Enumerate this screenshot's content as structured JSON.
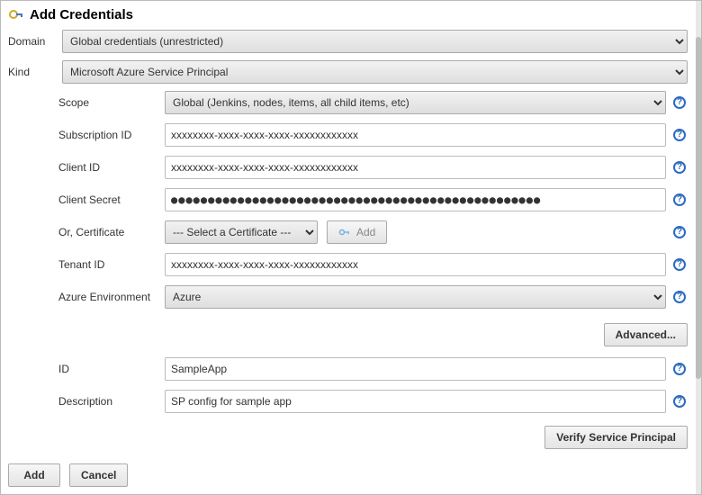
{
  "header": {
    "title": "Add Credentials"
  },
  "labels": {
    "domain": "Domain",
    "kind": "Kind",
    "scope": "Scope",
    "subscriptionId": "Subscription ID",
    "clientId": "Client ID",
    "clientSecret": "Client Secret",
    "orCertificate": "Or, Certificate",
    "tenantId": "Tenant ID",
    "azureEnvironment": "Azure Environment",
    "id": "ID",
    "description": "Description"
  },
  "domain": {
    "selected": "Global credentials (unrestricted)"
  },
  "kind": {
    "selected": "Microsoft Azure Service Principal"
  },
  "scope": {
    "selected": "Global (Jenkins, nodes, items, all child items, etc)"
  },
  "subscriptionId": {
    "value": "xxxxxxxx-xxxx-xxxx-xxxx-xxxxxxxxxxxx"
  },
  "clientId": {
    "value": "xxxxxxxx-xxxx-xxxx-xxxx-xxxxxxxxxxxx"
  },
  "clientSecret": {
    "masked": "●●●●●●●●●●●●●●●●●●●●●●●●●●●●●●●●●●●●●●●●●●●●●●●●●●"
  },
  "certificate": {
    "selected": "--- Select a Certificate ---",
    "addLabel": "Add"
  },
  "tenantId": {
    "value": "xxxxxxxx-xxxx-xxxx-xxxx-xxxxxxxxxxxx"
  },
  "azureEnvironment": {
    "selected": "Azure"
  },
  "advanced": {
    "label": "Advanced..."
  },
  "idField": {
    "value": "SampleApp"
  },
  "descriptionField": {
    "value": "SP config for sample app"
  },
  "verify": {
    "label": "Verify Service Principal"
  },
  "footer": {
    "add": "Add",
    "cancel": "Cancel"
  }
}
